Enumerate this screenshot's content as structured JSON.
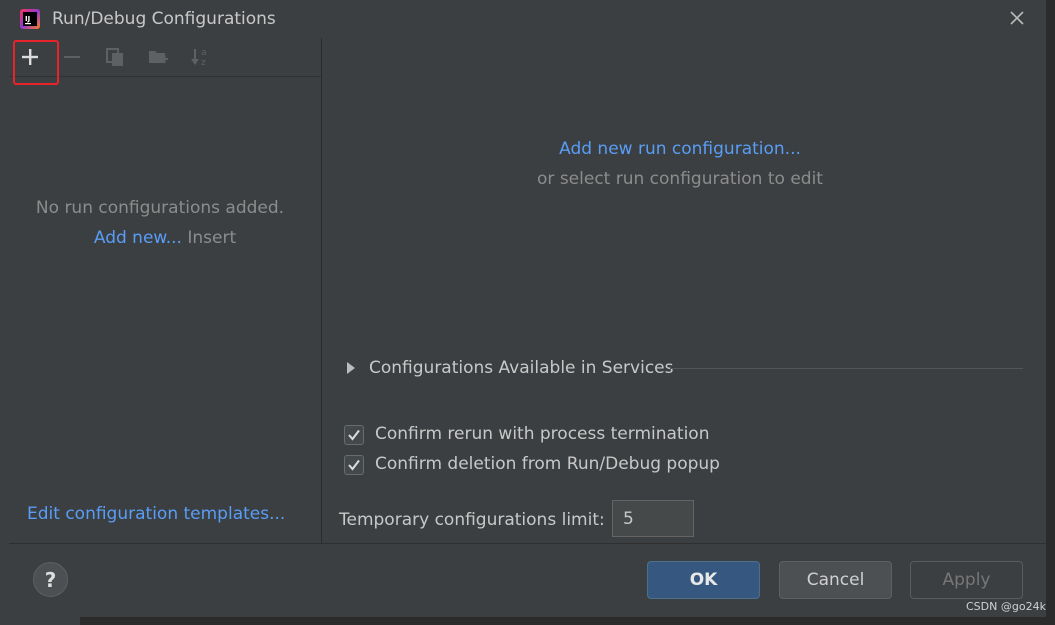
{
  "window": {
    "title": "Run/Debug Configurations"
  },
  "toolbar": {
    "buttons": [
      "add-icon",
      "remove-icon",
      "copy-icon",
      "folder-add-icon",
      "sort-alpha-icon"
    ]
  },
  "left_panel": {
    "empty_text": "No run configurations added.",
    "add_new_link": "Add new...",
    "insert_hint": "Insert",
    "templates_link": "Edit configuration templates..."
  },
  "right_panel": {
    "add_link": "Add new run configuration...",
    "select_hint": "or select run configuration to edit",
    "services_label": "Configurations Available in Services",
    "checkboxes": [
      {
        "label": "Confirm rerun with process termination",
        "checked": true
      },
      {
        "label": "Confirm deletion from Run/Debug popup",
        "checked": true
      }
    ],
    "limit_label": "Temporary configurations limit:",
    "limit_value": "5"
  },
  "footer": {
    "help": "?",
    "ok": "OK",
    "cancel": "Cancel",
    "apply": "Apply"
  },
  "watermark": "CSDN @go24k",
  "colors": {
    "link": "#589df6",
    "ok_button": "#365880",
    "highlight": "#e8232b"
  }
}
